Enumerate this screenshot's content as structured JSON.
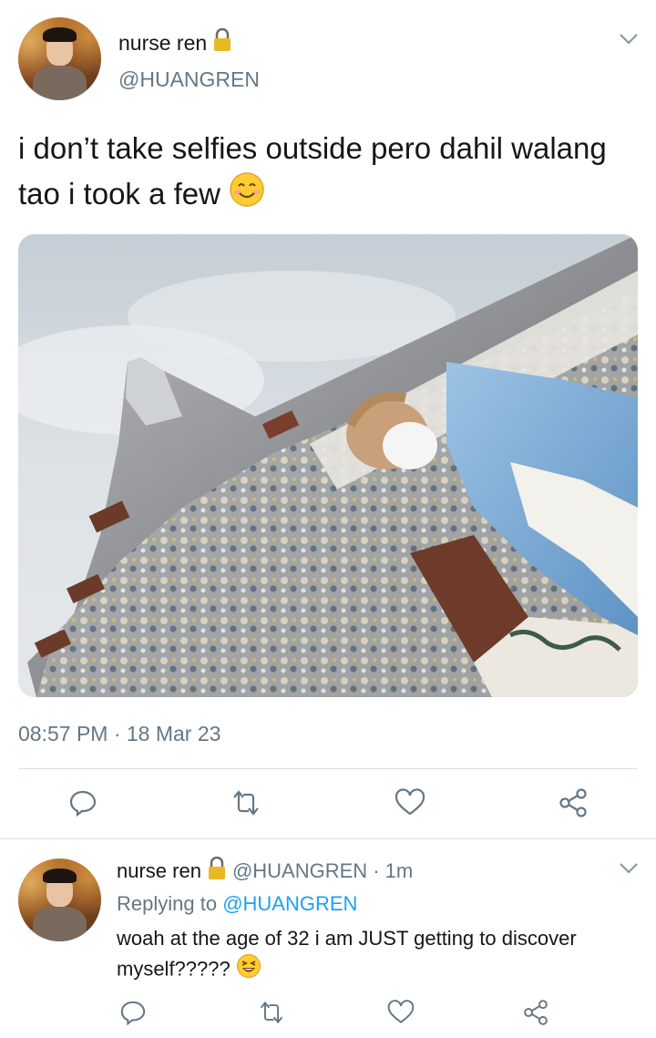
{
  "tweet": {
    "author_name": "nurse ren",
    "author_handle": "@HUANGREN",
    "text": "i don’t take selfies outside pero dahil walang tao i took a few",
    "text_emoji": "smiling-face-emoji",
    "image_icon": "photo-temple-selfie",
    "timestamp": "08:57 PM · 18 Mar 23",
    "actions": [
      "reply-icon",
      "retweet-icon",
      "like-icon",
      "share-icon"
    ]
  },
  "reply": {
    "author_name": "nurse ren",
    "author_handle": "@HUANGREN",
    "time": "· 1m",
    "replying_label": "Replying to",
    "replying_to": "@HUANGREN",
    "text": "woah at the age of 32 i am JUST getting to discover myself?????",
    "text_emoji": "grinning-squinting-emoji",
    "actions": [
      "reply-icon",
      "retweet-icon",
      "like-icon",
      "share-icon"
    ]
  },
  "colors": {
    "text": "#14171a",
    "muted": "#657786",
    "link": "#1da1f2",
    "divider": "#d9dfe3",
    "lock": "#e8b923"
  }
}
